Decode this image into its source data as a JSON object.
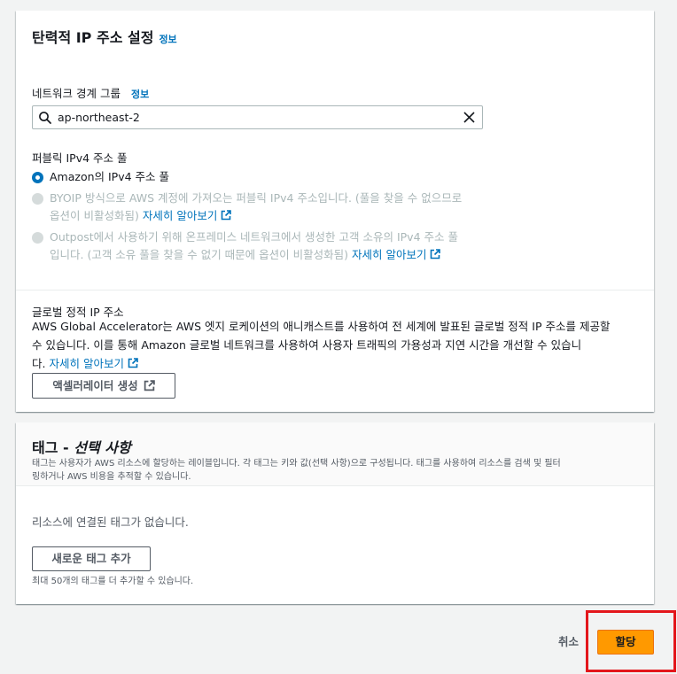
{
  "ip_settings": {
    "title": "탄력적 IP 주소 설정",
    "title_info": "정보",
    "network_border_group_label": "네트워크 경계 그룹",
    "network_border_group_info": "정보",
    "search_value": "ap-northeast-2",
    "pool_label": "퍼블릭 IPv4 주소 풀",
    "options": [
      {
        "line1": "Amazon의 IPv4 주소 풀",
        "line2": "",
        "link": "",
        "selected": true,
        "disabled": false
      },
      {
        "line1": "BYOIP 방식으로 AWS 계정에 가져오는 퍼블릭 IPv4 주소입니다. (풀을 찾을 수 없으므로",
        "line2": "옵션이 비활성화됨)",
        "link": "자세히 알아보기",
        "selected": false,
        "disabled": true
      },
      {
        "line1": "Outpost에서 사용하기 위해 온프레미스 네트워크에서 생성한 고객 소유의 IPv4 주소 풀",
        "line2": "입니다. (고객 소유 풀을 찾을 수 없기 때문에 옵션이 비활성화됨)",
        "link": "자세히 알아보기",
        "selected": false,
        "disabled": true
      }
    ],
    "global_ip_label": "글로벌 정적 IP 주소",
    "global_ip_line1": "AWS Global Accelerator는 AWS 엣지 로케이션의 애니캐스트를 사용하여 전 세계에 발표된 글로벌 정적 IP 주소를 제공할",
    "global_ip_line2": "수 있습니다. 이를 통해 Amazon 글로벌 네트워크를 사용하여 사용자 트래픽의 가용성과 지연 시간을 개선할 수 있습니",
    "global_ip_line3_prefix": "다.",
    "global_ip_link": "자세히 알아보기",
    "accelerator_button": "액셀러레이터 생성"
  },
  "tags": {
    "title_prefix": "태그 - ",
    "title_optional": "선택 사항",
    "desc_line1": "태그는 사용자가 AWS 리소스에 할당하는 레이블입니다. 각 태그는 키와 값(선택 사항)으로 구성됩니다. 태그를 사용하여 리소스를 검색 및 필터",
    "desc_line2": "링하거나 AWS 비용을 추적할 수 있습니다.",
    "empty_text": "리소스에 연결된 태그가 없습니다.",
    "add_button": "새로운 태그 추가",
    "limit_text": "최대 50개의 태그를 더 추가할 수 있습니다."
  },
  "footer": {
    "cancel": "취소",
    "submit": "할당"
  },
  "colors": {
    "primary": "#ff9900",
    "link": "#0073bb",
    "highlight": "#e3161b"
  }
}
